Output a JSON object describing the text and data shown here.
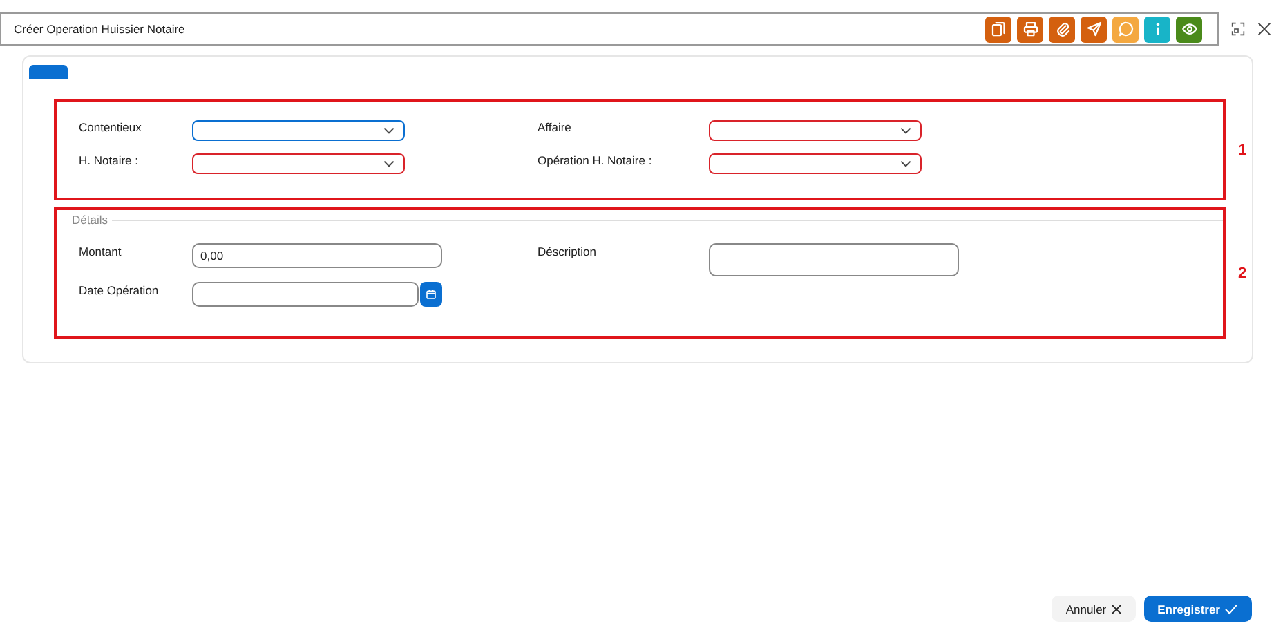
{
  "window": {
    "title": "Créer Operation Huissier Notaire"
  },
  "toolbar": [
    {
      "kind": "documents",
      "color": "#d4600f"
    },
    {
      "kind": "print",
      "color": "#d4600f"
    },
    {
      "kind": "attach",
      "color": "#d4600f"
    },
    {
      "kind": "send",
      "color": "#d4600f"
    },
    {
      "kind": "comment",
      "color": "#f4a840"
    },
    {
      "kind": "info",
      "color": "#18b4c8"
    },
    {
      "kind": "view",
      "color": "#4a8a1a"
    }
  ],
  "tabs": [
    {
      "selected": true
    }
  ],
  "sections": [
    {
      "annotation": "1",
      "fields": [
        {
          "label": "Contentieux",
          "kind": "select",
          "focused": true,
          "invalid": false
        },
        {
          "label": "Affaire",
          "kind": "select",
          "focused": false,
          "invalid": true
        },
        {
          "label": "H. Notaire :",
          "kind": "select",
          "focused": false,
          "invalid": true
        },
        {
          "label": "Opération H. Notaire :",
          "kind": "select",
          "focused": false,
          "invalid": true
        }
      ]
    },
    {
      "annotation": "2",
      "legend": "Détails",
      "fields": [
        {
          "label": "Montant",
          "kind": "text",
          "value": "0,00"
        },
        {
          "label": "Déscription",
          "kind": "textarea"
        },
        {
          "label": "Date Opération",
          "kind": "date"
        }
      ]
    }
  ],
  "buttons": [
    {
      "label": "Annuler",
      "kind": "cancel"
    },
    {
      "label": "Enregistrer",
      "kind": "save"
    }
  ]
}
